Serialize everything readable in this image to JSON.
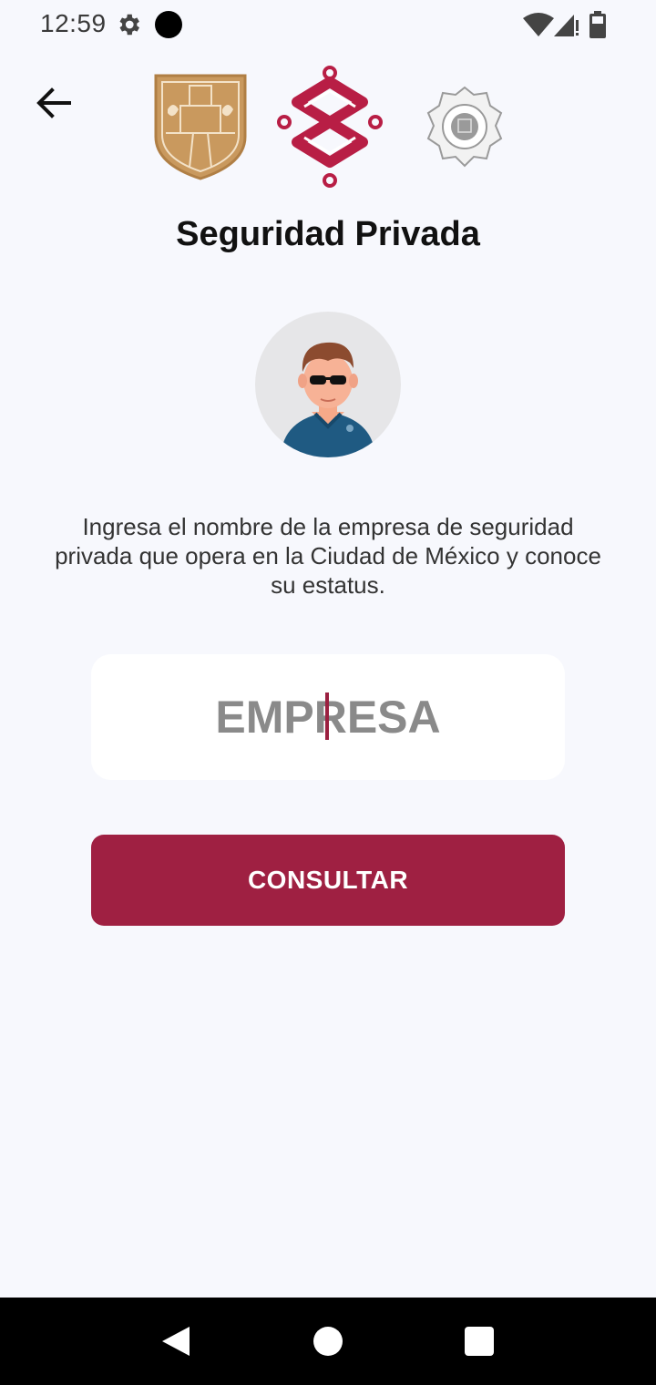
{
  "status_bar": {
    "time": "12:59",
    "icons": [
      "gear-icon",
      "dot-icon",
      "wifi-icon",
      "signal-icon",
      "battery-icon"
    ]
  },
  "header": {
    "back_icon": "arrow-left-icon",
    "logos": [
      "cdmx-shield-logo",
      "cdmx-knot-logo",
      "police-badge-logo"
    ],
    "title": "Seguridad Privada"
  },
  "main": {
    "avatar_icon": "security-guard-avatar",
    "description": "Ingresa el nombre de la empresa de seguridad privada que opera en la Ciudad de México y conoce su estatus.",
    "search": {
      "placeholder": "EMPRESA",
      "value": ""
    },
    "consult_label": "CONSULTAR"
  },
  "nav_bar": {
    "icons": [
      "nav-back-icon",
      "nav-home-icon",
      "nav-recent-icon"
    ]
  },
  "colors": {
    "background": "#f7f8fd",
    "brand": "#9f2042",
    "shield_gold": "#c9995e",
    "text": "#111111"
  }
}
